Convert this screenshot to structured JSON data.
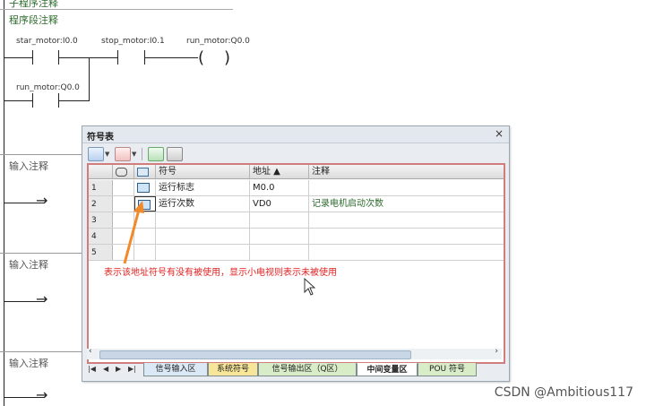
{
  "ladder": {
    "header_partial": "子程序注释",
    "segment_note": "程序段注释",
    "contacts": {
      "start": "star_motor:I0.0",
      "stop": "stop_motor:I0.1",
      "coil": "run_motor:Q0.0",
      "latch": "run_motor:Q0.0"
    },
    "input_notes": [
      "输入注释",
      "输入注释",
      "输入注释"
    ]
  },
  "symbol_table": {
    "title": "符号表",
    "close": "×",
    "columns": {
      "symbol": "符号",
      "address": "地址 ▲",
      "comment": "注释"
    },
    "rows": [
      {
        "num": "1",
        "symbol": "运行标志",
        "address": "M0.0",
        "comment": ""
      },
      {
        "num": "2",
        "symbol": "运行次数",
        "address": "VD0",
        "comment": "记录电机启动次数"
      },
      {
        "num": "3",
        "symbol": "",
        "address": "",
        "comment": ""
      },
      {
        "num": "4",
        "symbol": "",
        "address": "",
        "comment": ""
      },
      {
        "num": "5",
        "symbol": "",
        "address": "",
        "comment": ""
      }
    ],
    "annotation": "表示该地址符号有没有被使用，显示小电视则表示未被使用",
    "tabs": [
      "信号输入区",
      "系统符号",
      "信号输出区（Q区）",
      "中间变量区",
      "POU 符号"
    ],
    "nav": [
      "|◀",
      "◀",
      "▶",
      "▶|"
    ]
  },
  "watermark": "CSDN @Ambitious117"
}
